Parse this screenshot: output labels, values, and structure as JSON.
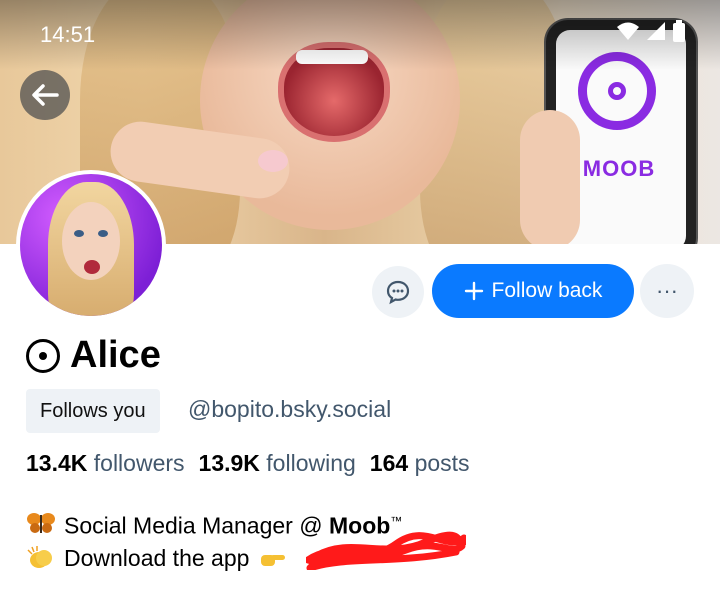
{
  "status_bar": {
    "time": "14:51"
  },
  "banner": {
    "phone_brand": "MOOB"
  },
  "profile": {
    "display_name": "Alice",
    "follows_you_label": "Follows you",
    "handle": "@bopito.bsky.social",
    "stats": {
      "followers_count": "13.4K",
      "followers_label": "followers",
      "following_count": "13.9K",
      "following_label": "following",
      "posts_count": "164",
      "posts_label": "posts"
    },
    "bio": {
      "line1_prefix": "Social Media Manager @ ",
      "line1_brand": "Moob",
      "line1_tm": "™",
      "line2": "Download the app"
    }
  },
  "actions": {
    "follow_back_label": "Follow back",
    "more_label": "···"
  },
  "colors": {
    "accent": "#0a7aff",
    "moob_purple": "#8a2be2",
    "muted_text": "#42576c",
    "button_bg": "#eef2f6"
  },
  "icons": [
    "back-arrow-icon",
    "wifi-icon",
    "signal-icon",
    "battery-icon",
    "chat-bubble-icon",
    "plus-icon",
    "more-dots-icon",
    "moob-logo-icon",
    "butterfly-icon",
    "clapping-hands-icon",
    "pointing-hand-icon"
  ]
}
